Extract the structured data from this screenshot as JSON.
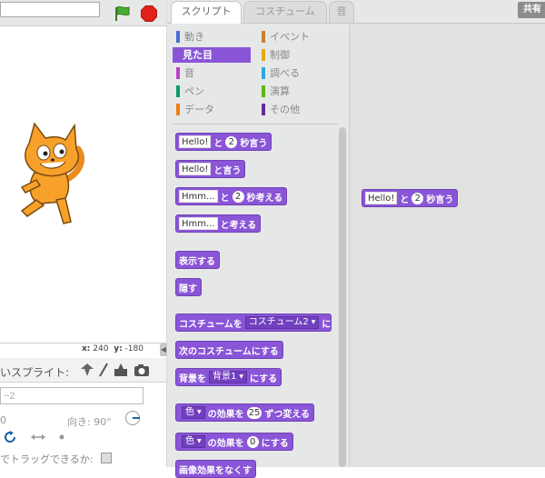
{
  "stage": {
    "project_title": "",
    "coords": {
      "x_label": "x:",
      "x_value": "240",
      "y_label": "y:",
      "y_value": "-180"
    }
  },
  "sprites": {
    "new_sprite_label": "新しいスプライト:",
    "visible_label_fragment": "いスプライト:",
    "name_value": "~2",
    "x_fragment": "0",
    "direction_label": "向き:",
    "direction_value": "90°",
    "draggable_label_fragment": "でトラッグできるか:"
  },
  "tabs": [
    {
      "label": "スクリプト"
    },
    {
      "label": "コスチューム"
    },
    {
      "label": "音"
    }
  ],
  "share_label": "共有",
  "categories": [
    {
      "label": "動き",
      "color": "#4a6cd4"
    },
    {
      "label": "イベント",
      "color": "#c88330"
    },
    {
      "label": "見た目",
      "color": "#8a55d7"
    },
    {
      "label": "制御",
      "color": "#e1a91a"
    },
    {
      "label": "音",
      "color": "#bb42c3"
    },
    {
      "label": "調べる",
      "color": "#2ca5e2"
    },
    {
      "label": "ペン",
      "color": "#0e9a6c"
    },
    {
      "label": "演算",
      "color": "#5cb712"
    },
    {
      "label": "データ",
      "color": "#ee7d16"
    },
    {
      "label": "その他",
      "color": "#632d99"
    }
  ],
  "blocks": {
    "b1": {
      "slot": "Hello!",
      "mid": "と",
      "num": "2",
      "tail": "秒言う"
    },
    "b2": {
      "slot": "Hello!",
      "tail": "と言う"
    },
    "b3": {
      "slot": "Hmm...",
      "mid": "と",
      "num": "2",
      "tail": "秒考える"
    },
    "b4": {
      "slot": "Hmm...",
      "tail": "と考える"
    },
    "b5": {
      "text": "表示する"
    },
    "b6": {
      "text": "隠す"
    },
    "b7": {
      "head": "コスチュームを",
      "drop": "コスチューム2",
      "tail": "に"
    },
    "b8": {
      "text": "次のコスチュームにする"
    },
    "b9": {
      "head": "背景を",
      "drop": "背景1",
      "tail": "にする"
    },
    "b10": {
      "drop": "色",
      "mid": "の効果を",
      "num": "25",
      "tail": "ずつ変える"
    },
    "b11": {
      "drop": "色",
      "mid": "の効果を",
      "num": "0",
      "tail": "にする"
    },
    "b12": {
      "text": "画像効果をなくす"
    }
  },
  "script_block": {
    "slot": "Hello!",
    "mid": "と",
    "num": "2",
    "tail": "秒言う"
  },
  "colors": {
    "looks": "#8a55d7",
    "flag": "#3b9b2c",
    "stop": "#e0201c"
  }
}
